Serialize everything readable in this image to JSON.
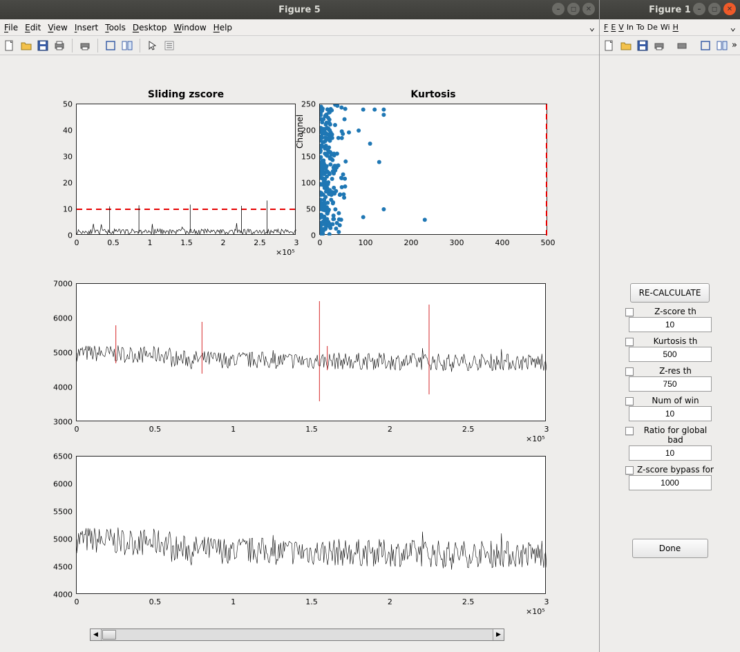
{
  "win5": {
    "title": "Figure 5"
  },
  "win1": {
    "title": "Figure 1"
  },
  "menus": {
    "file": "File",
    "edit": "Edit",
    "view": "View",
    "insert": "Insert",
    "tools": "Tools",
    "desktop": "Desktop",
    "window": "Window",
    "help": "Help",
    "short": {
      "file": "F",
      "edit": "E",
      "view": "V",
      "insert": "In",
      "tools": "To",
      "desktop": "De",
      "window": "Wi",
      "help": "H"
    }
  },
  "sidebar": {
    "recalculate": "RE-CALCULATE",
    "params": [
      {
        "label": "Z-score th",
        "value": "10"
      },
      {
        "label": "Kurtosis th",
        "value": "500"
      },
      {
        "label": "Z-res th",
        "value": "750"
      },
      {
        "label": "Num of win",
        "value": "10"
      },
      {
        "label": "Ratio for global bad",
        "value": "10"
      },
      {
        "label": "Z-score bypass for",
        "value": "1000"
      }
    ],
    "done": "Done"
  },
  "chart_data": [
    {
      "name": "sliding_zscore",
      "type": "line",
      "title": "Sliding zscore",
      "xlim": [
        0,
        300000
      ],
      "ylim": [
        0,
        50
      ],
      "xticks": [
        0,
        0.5,
        1,
        1.5,
        2,
        2.5,
        3
      ],
      "xpow": "×10⁵",
      "yticks": [
        0,
        10,
        20,
        30,
        40,
        50
      ],
      "threshold": 10,
      "description": "noisy baseline ≈1–3  with ~5 narrow spikes reaching 10–15"
    },
    {
      "name": "kurtosis",
      "type": "scatter",
      "title": "Kurtosis",
      "ylabel": "Channel",
      "xlim": [
        0,
        500
      ],
      "ylim": [
        0,
        250
      ],
      "xticks": [
        0,
        100,
        200,
        300,
        400,
        500
      ],
      "yticks": [
        0,
        50,
        100,
        150,
        200,
        250
      ],
      "threshold_x": 500,
      "description": "dense cluster of points at x≈0–80 spanning y=0–250, sparse points x≈100–230"
    },
    {
      "name": "channel_trace_flagged",
      "type": "line",
      "xlim": [
        0,
        300000
      ],
      "ylim": [
        3000,
        7000
      ],
      "xticks": [
        0,
        0.5,
        1,
        1.5,
        2,
        2.5,
        3
      ],
      "xpow": "×10⁵",
      "yticks": [
        3000,
        4000,
        5000,
        6000,
        7000
      ],
      "baseline": 4800,
      "flags_x": [
        25000,
        80000,
        155000,
        160000,
        225000
      ],
      "description": "noisy trace ~4600–5200, red vertical flag lines reaching ~5800–6500"
    },
    {
      "name": "channel_trace_clean",
      "type": "line",
      "xlim": [
        0,
        300000
      ],
      "ylim": [
        4000,
        6500
      ],
      "xticks": [
        0,
        0.5,
        1,
        1.5,
        2,
        2.5,
        3
      ],
      "xpow": "×10⁵",
      "yticks": [
        4000,
        4500,
        5000,
        5500,
        6000,
        6500
      ],
      "baseline": 4800,
      "description": "same noisy trace without flags"
    }
  ]
}
